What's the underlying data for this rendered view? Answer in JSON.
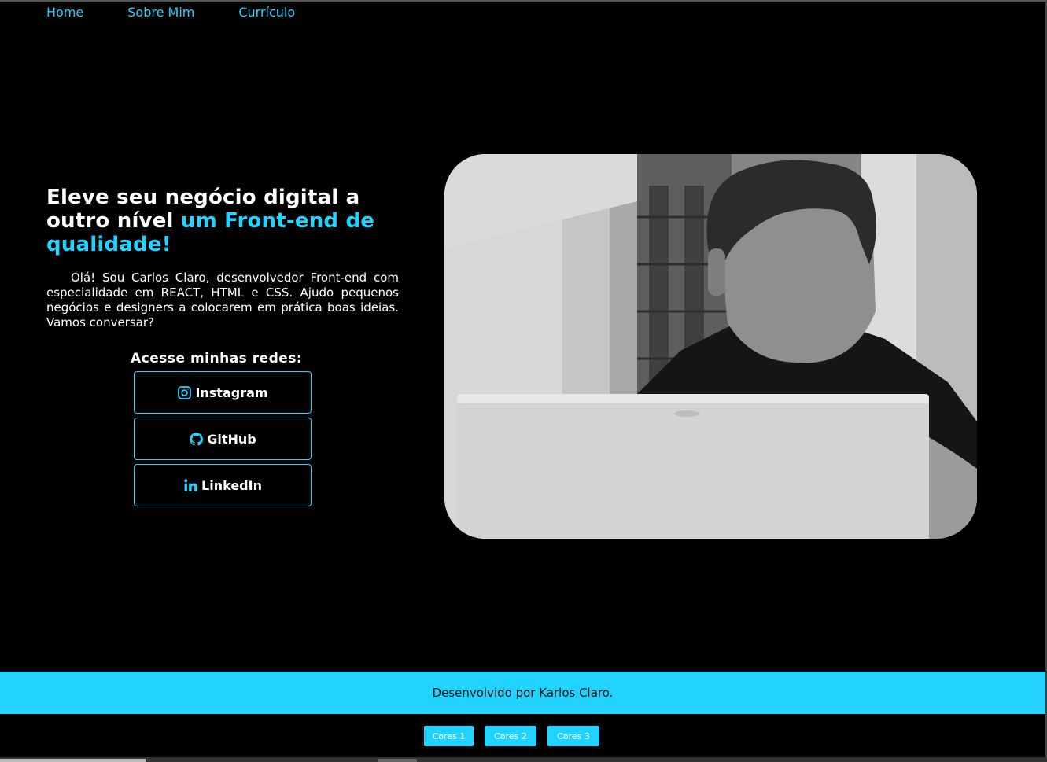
{
  "nav": {
    "items": [
      {
        "label": "Home"
      },
      {
        "label": "Sobre Mim"
      },
      {
        "label": "Currículo"
      }
    ]
  },
  "hero": {
    "headline_part1": "Eleve seu negócio digital a outro nível ",
    "headline_accent": "um Front-end de qualidade!",
    "intro": "Olá! Sou Carlos Claro, desenvolvedor Front-end com especialidade em REACT, HTML e CSS. Ajudo pequenos negócios e designers a colocarem em prática boas ideias. Vamos conversar?"
  },
  "social": {
    "title": "Acesse minhas redes:",
    "buttons": [
      {
        "label": "Instagram",
        "icon": "instagram-icon"
      },
      {
        "label": "GitHub",
        "icon": "github-icon"
      },
      {
        "label": "LinkedIn",
        "icon": "linkedin-icon"
      }
    ]
  },
  "photo": {
    "alt": "Foto de perfil em preto e branco"
  },
  "footer": {
    "text": "Desenvolvido por Karlos Claro."
  },
  "theme_buttons": [
    {
      "label": "Cores 1"
    },
    {
      "label": "Cores 2"
    },
    {
      "label": "Cores 3"
    }
  ],
  "colors": {
    "accent": "#22d3ff",
    "background": "#000000"
  }
}
